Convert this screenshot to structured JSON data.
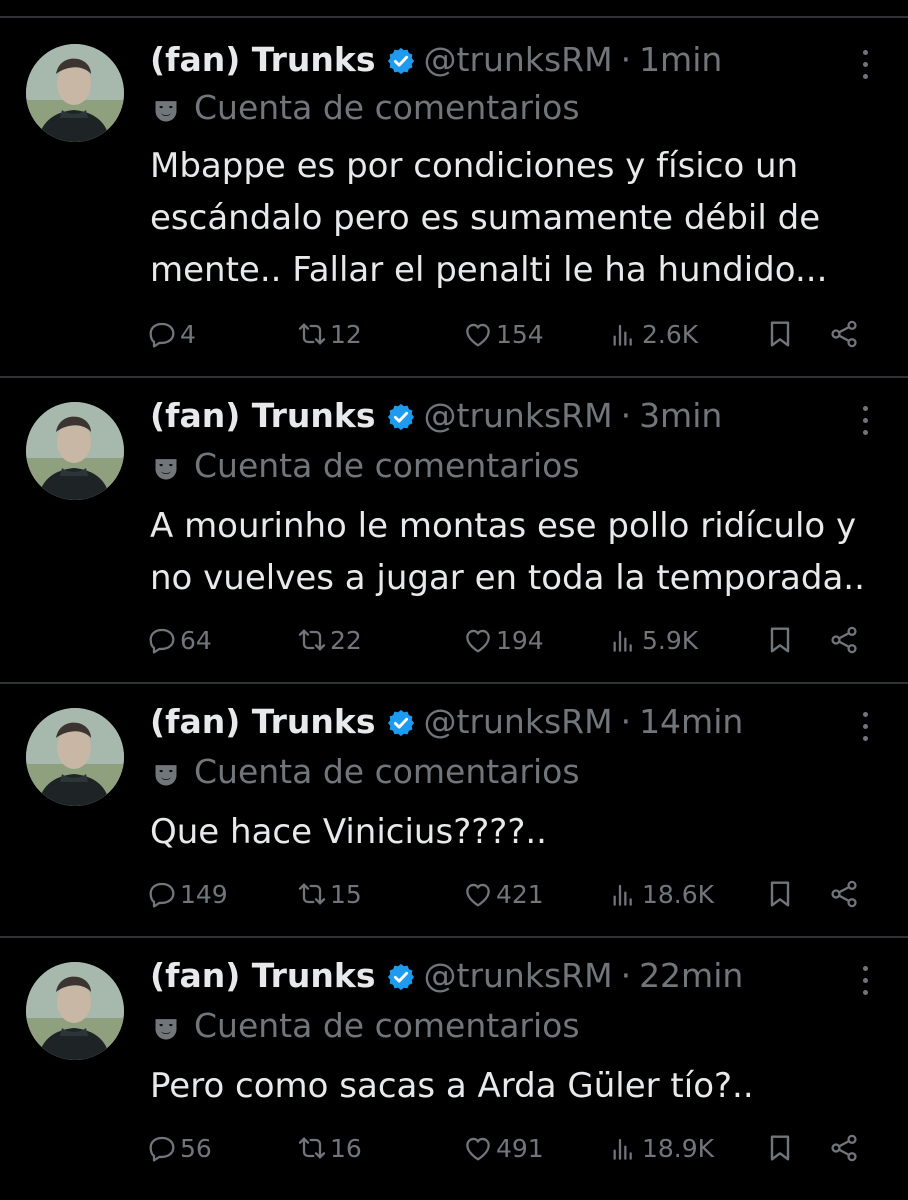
{
  "author": {
    "name": "(fan) Trunks",
    "handle": "@trunksRM",
    "sep": "·",
    "account_label": "Cuenta de comentarios"
  },
  "colors": {
    "background": "#000000",
    "text": "#e7e9ea",
    "muted": "#71767b",
    "verified": "#1d9bf0",
    "divider": "#2f3336"
  },
  "tweets": [
    {
      "time": "1min",
      "lines": [
        "Mbappe es por condiciones y físico un",
        "escándalo pero es sumamente débil de",
        "mente.. Fallar el penalti le ha hundido..."
      ],
      "replies": "4",
      "reposts": "12",
      "likes": "154",
      "views": "2.6K"
    },
    {
      "time": "3min",
      "lines": [
        "A mourinho le montas ese pollo ridículo y",
        "no vuelves a jugar en toda la temporada.."
      ],
      "replies": "64",
      "reposts": "22",
      "likes": "194",
      "views": "5.9K"
    },
    {
      "time": "14min",
      "lines": [
        "Que hace Vinicius????.."
      ],
      "replies": "149",
      "reposts": "15",
      "likes": "421",
      "views": "18.6K"
    },
    {
      "time": "22min",
      "lines": [
        "Pero como sacas a Arda Güler tío?.."
      ],
      "replies": "56",
      "reposts": "16",
      "likes": "491",
      "views": "18.9K"
    }
  ],
  "icons": {
    "reply": "reply-icon",
    "repost": "repost-icon",
    "like": "heart-icon",
    "views": "views-icon",
    "bookmark": "bookmark-icon",
    "share": "share-icon",
    "more": "more-options-icon",
    "verified": "verified-badge-icon",
    "account": "mask-icon"
  }
}
